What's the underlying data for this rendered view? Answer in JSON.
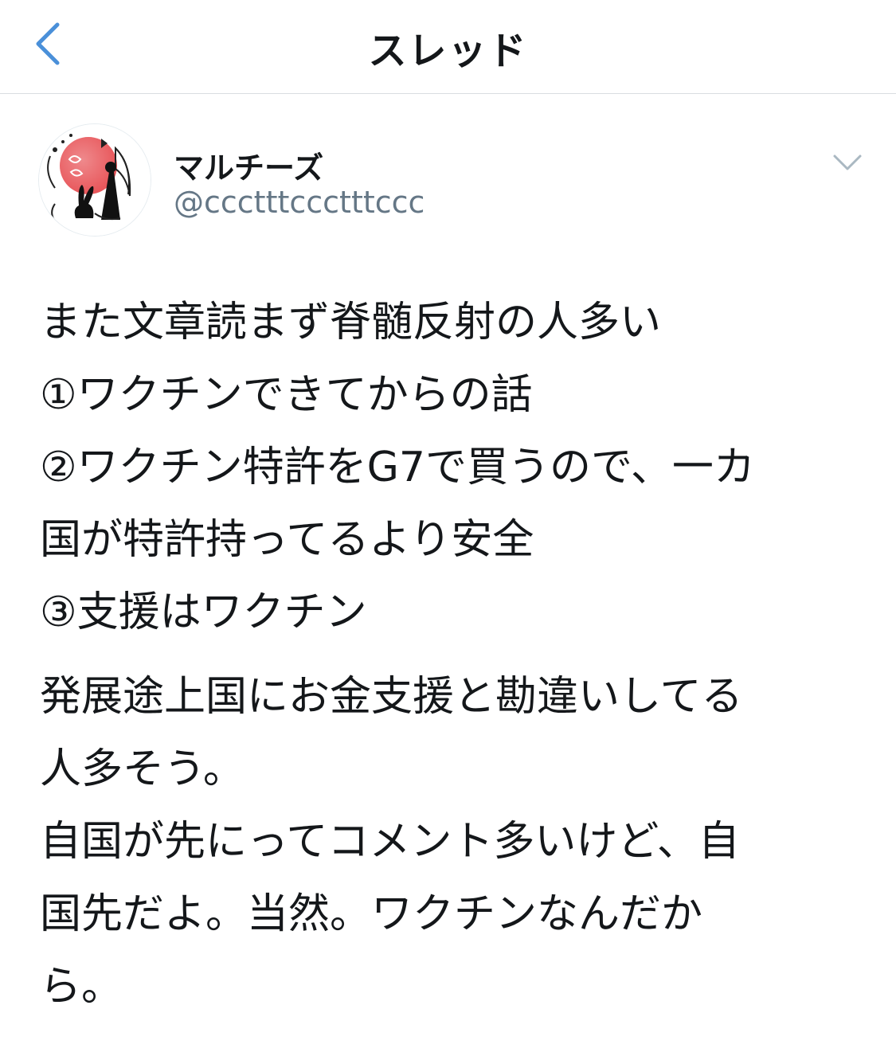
{
  "nav": {
    "title": "スレッド"
  },
  "tweet": {
    "display_name": "マルチーズ",
    "handle": "@ccctttccctttccc",
    "paragraph1": [
      "また文章読まず脊髄反射の人多い",
      "①ワクチンできてからの話",
      "②ワクチン特許をG7で買うので、一カ",
      "国が特許持ってるより安全",
      "③支援はワクチン"
    ],
    "paragraph2": [
      "発展途上国にお金支援と勘違いしてる",
      "人多そう。",
      "自国が先にってコメント多いけど、自",
      "国先だよ。当然。ワクチンなんだか",
      "ら。"
    ]
  },
  "colors": {
    "accent": "#4a90d9",
    "text": "#14171a",
    "secondary": "#657786",
    "divider": "#d9dde1"
  },
  "icons": {
    "back": "chevron-left-icon",
    "menu": "chevron-down-icon"
  }
}
